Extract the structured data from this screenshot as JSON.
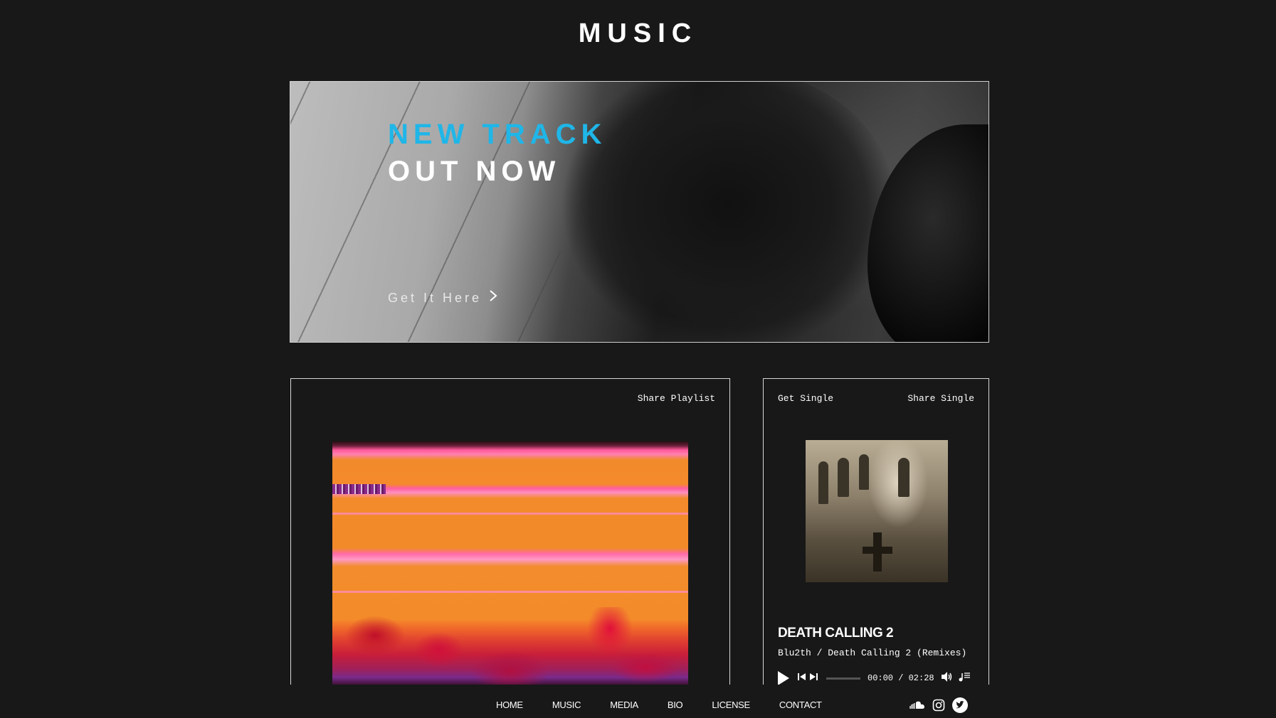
{
  "page": {
    "title": "MUSIC"
  },
  "hero": {
    "headline_accent": "NEW TRACK",
    "headline_main": "OUT NOW",
    "cta_label": "Get It Here",
    "accent_color": "#1fb6e8"
  },
  "playlist": {
    "share_label": "Share Playlist"
  },
  "single": {
    "get_label": "Get Single",
    "share_label": "Share Single",
    "title": "DEATH CALLING 2",
    "subtitle": "Blu2th / Death Calling 2 (Remixes)",
    "time": "00:00 / 02:28"
  },
  "nav": {
    "items": [
      "HOME",
      "MUSIC",
      "MEDIA",
      "BIO",
      "LICENSE",
      "CONTACT"
    ],
    "social": [
      "soundcloud-icon",
      "instagram-icon",
      "twitter-icon"
    ]
  }
}
